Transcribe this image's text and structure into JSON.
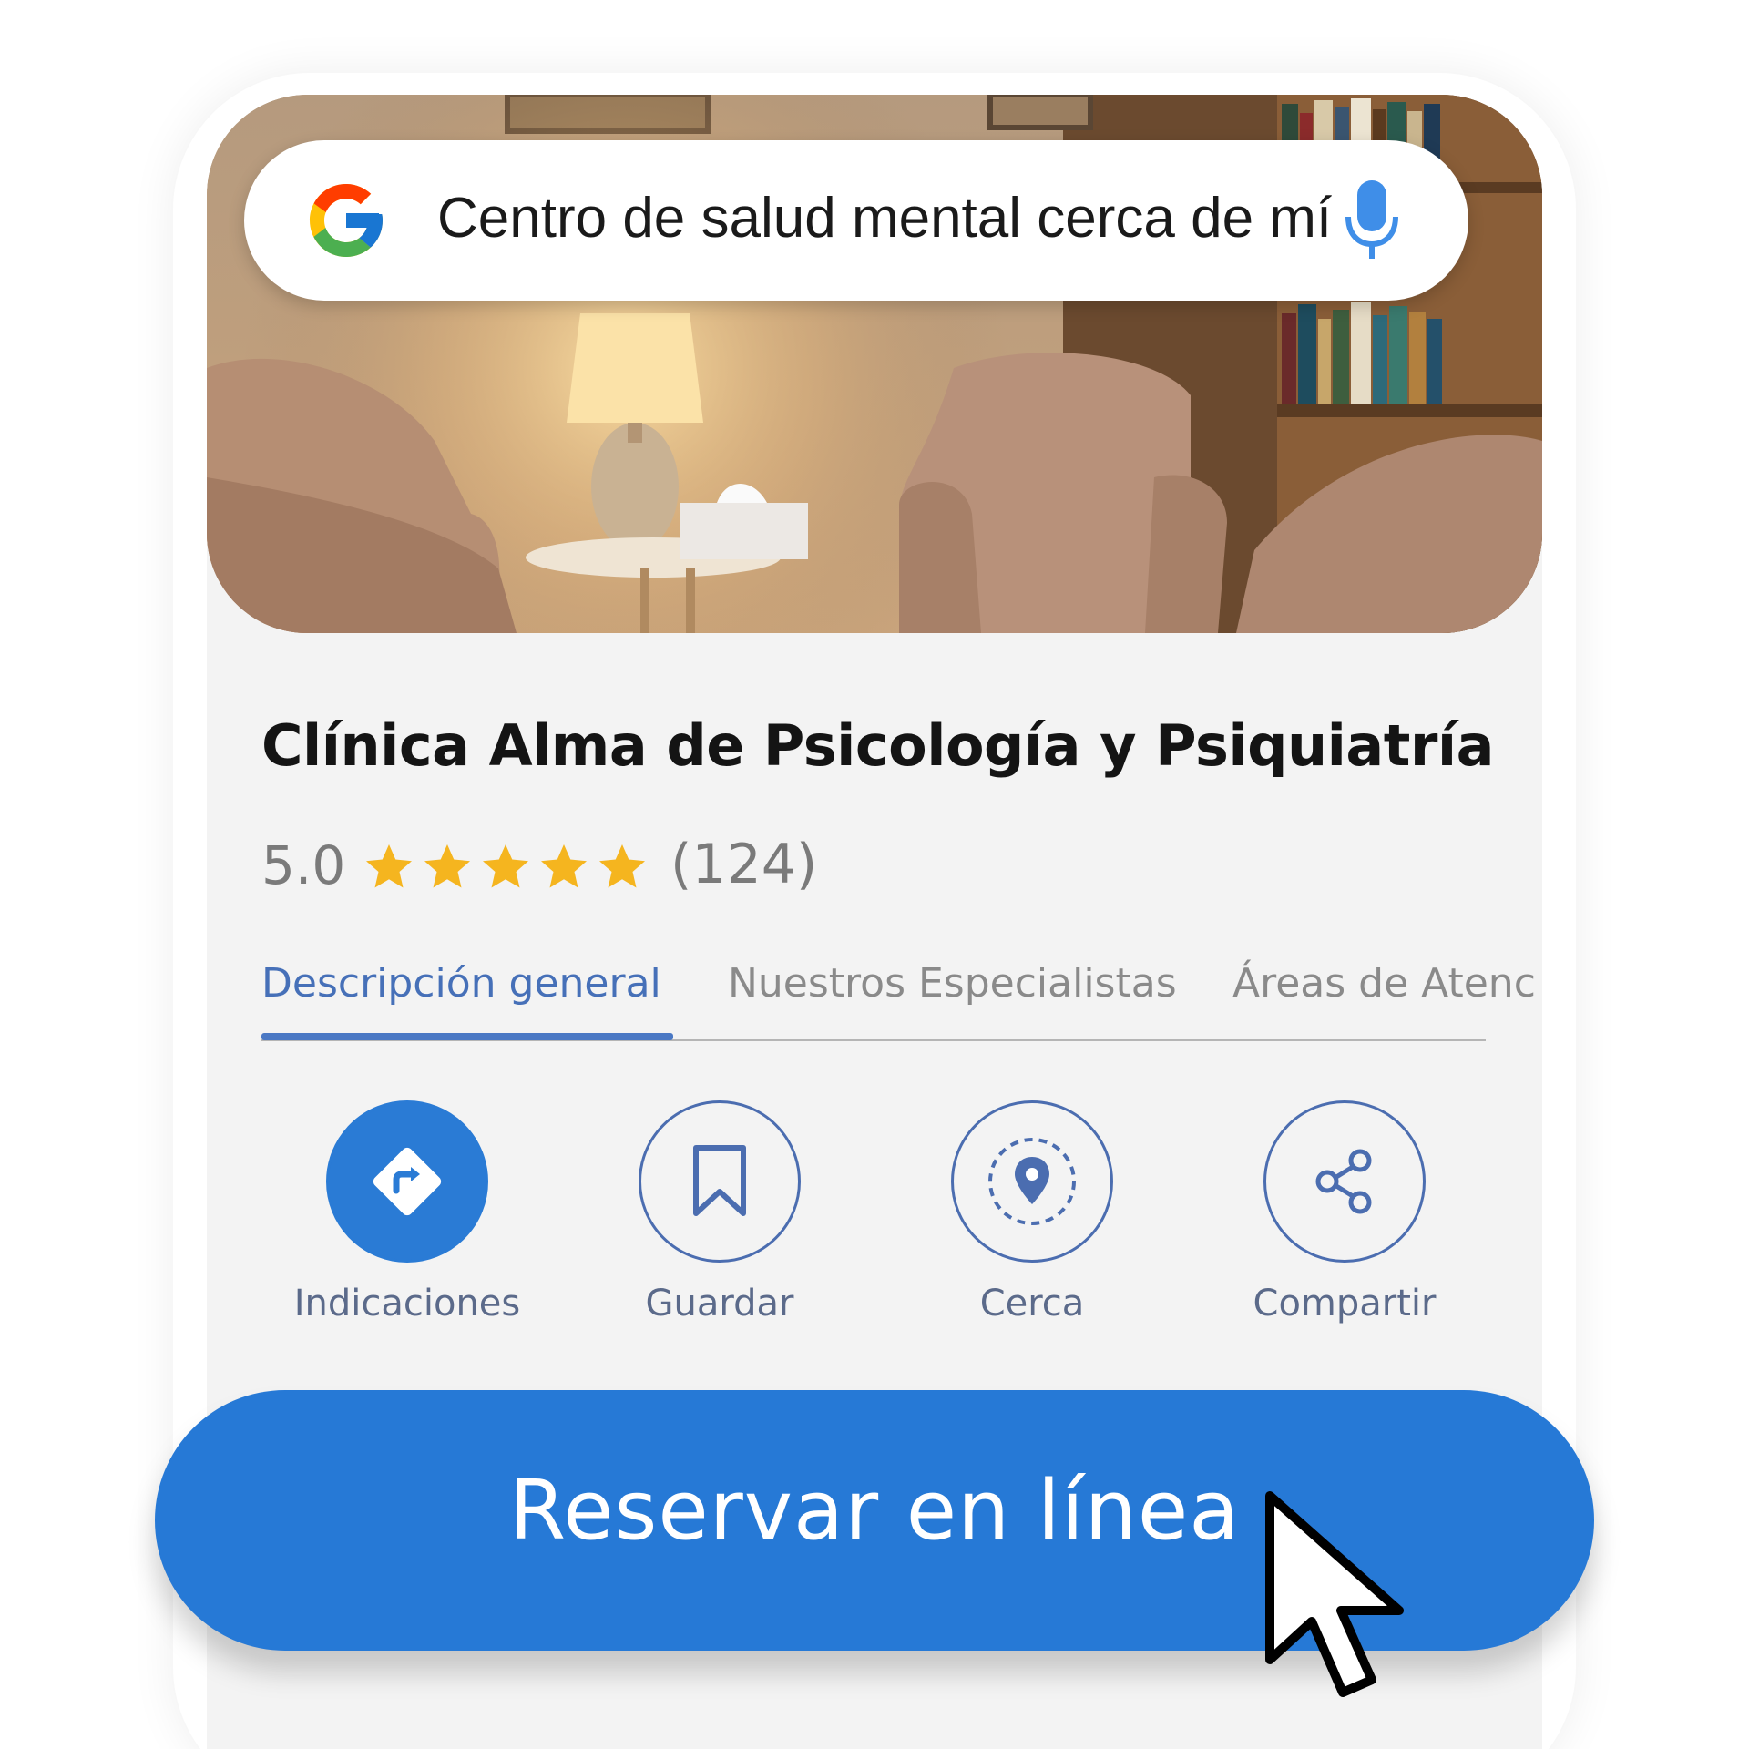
{
  "search": {
    "query": "Centro de salud mental cerca de mí",
    "logo_icon": "google-g-icon",
    "mic_icon": "microphone-icon"
  },
  "place": {
    "name": "Clínica Alma de Psicología y Psiquiatría",
    "rating": "5.0",
    "stars": 5,
    "review_count": "(124)"
  },
  "tabs": [
    {
      "label": "Descripción general",
      "active": true
    },
    {
      "label": "Nuestros Especialistas",
      "active": false
    },
    {
      "label": "Áreas de Atenc",
      "active": false
    }
  ],
  "actions": [
    {
      "label": "Indicaciones",
      "icon": "directions-icon"
    },
    {
      "label": "Guardar",
      "icon": "bookmark-icon"
    },
    {
      "label": "Cerca",
      "icon": "nearby-pin-icon"
    },
    {
      "label": "Compartir",
      "icon": "share-icon"
    }
  ],
  "cta": {
    "label": "Reservar en línea"
  },
  "colors": {
    "accent": "#2679d6",
    "tab_active": "#4670b8",
    "star": "#f5b51f",
    "outline": "#4b6db0"
  }
}
